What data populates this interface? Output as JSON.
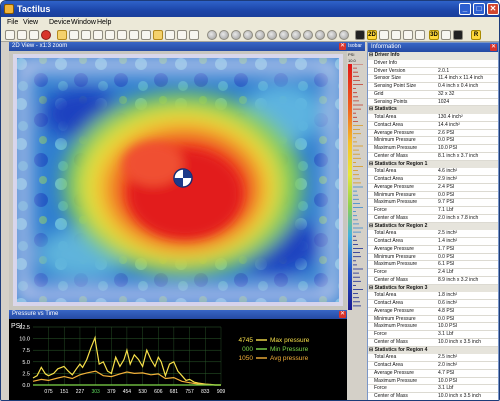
{
  "window": {
    "title": "Tactilus",
    "minimize": "_",
    "maximize": "□",
    "close": "✕"
  },
  "menu": [
    "File",
    "View",
    "Device",
    "Window",
    "Help"
  ],
  "view2d": {
    "title": "2D View - x1:3 zoom"
  },
  "isobar": {
    "title": "Isobar",
    "unit": "PSI",
    "top_value": "10.0"
  },
  "information": {
    "title": "Information",
    "rows": [
      {
        "type": "section",
        "label": "Driver Info"
      },
      {
        "type": "row",
        "label": "Driver Info",
        "value": ""
      },
      {
        "type": "row",
        "label": "Driver Version",
        "value": "2.0.1"
      },
      {
        "type": "row",
        "label": "Sensor Size",
        "value": "11.4 inch x 11.4 inch"
      },
      {
        "type": "row",
        "label": "Sensing Point Size",
        "value": "0.4 inch x 0.4 inch"
      },
      {
        "type": "row",
        "label": "Grid",
        "value": "32 x 32"
      },
      {
        "type": "row",
        "label": "Sensing Points",
        "value": "1024"
      },
      {
        "type": "section",
        "label": "Statistics"
      },
      {
        "type": "row",
        "label": "Total Area",
        "value": "130.4 inch²"
      },
      {
        "type": "row",
        "label": "Contact Area",
        "value": "14.4 inch²"
      },
      {
        "type": "row",
        "label": "Average Pressure",
        "value": "2.6 PSI"
      },
      {
        "type": "row",
        "label": "Minimum Pressure",
        "value": "0.0 PSI"
      },
      {
        "type": "row",
        "label": "Maximum Pressure",
        "value": "10.0 PSI"
      },
      {
        "type": "row",
        "label": "Center of Mass",
        "value": "8.1 inch x 3.7 inch"
      },
      {
        "type": "section",
        "label": "Statistics for Region 1"
      },
      {
        "type": "row",
        "label": "Total Area",
        "value": "4.6 inch²"
      },
      {
        "type": "row",
        "label": "Contact Area",
        "value": "2.9 inch²"
      },
      {
        "type": "row",
        "label": "Average Pressure",
        "value": "2.4 PSI"
      },
      {
        "type": "row",
        "label": "Minimum Pressure",
        "value": "0.0 PSI"
      },
      {
        "type": "row",
        "label": "Maximum Pressure",
        "value": "9.7 PSI"
      },
      {
        "type": "row",
        "label": "Force",
        "value": "7.1 Lbf"
      },
      {
        "type": "row",
        "label": "Center of Mass",
        "value": "2.0 inch x 7.8 inch"
      },
      {
        "type": "section",
        "label": "Statistics for Region 2"
      },
      {
        "type": "row",
        "label": "Total Area",
        "value": "2.5 inch²"
      },
      {
        "type": "row",
        "label": "Contact Area",
        "value": "1.4 inch²"
      },
      {
        "type": "row",
        "label": "Average Pressure",
        "value": "1.7 PSI"
      },
      {
        "type": "row",
        "label": "Minimum Pressure",
        "value": "0.0 PSI"
      },
      {
        "type": "row",
        "label": "Maximum Pressure",
        "value": "6.1 PSI"
      },
      {
        "type": "row",
        "label": "Force",
        "value": "2.4 Lbf"
      },
      {
        "type": "row",
        "label": "Center of Mass",
        "value": "8.9 inch x 3.2 inch"
      },
      {
        "type": "section",
        "label": "Statistics for Region 3"
      },
      {
        "type": "row",
        "label": "Total Area",
        "value": "1.8 inch²"
      },
      {
        "type": "row",
        "label": "Contact Area",
        "value": "0.6 inch²"
      },
      {
        "type": "row",
        "label": "Average Pressure",
        "value": "4.8 PSI"
      },
      {
        "type": "row",
        "label": "Minimum Pressure",
        "value": "0.0 PSI"
      },
      {
        "type": "row",
        "label": "Maximum Pressure",
        "value": "10.0 PSI"
      },
      {
        "type": "row",
        "label": "Force",
        "value": "3.1 Lbf"
      },
      {
        "type": "row",
        "label": "Center of Mass",
        "value": "10.0 inch x 3.5 inch"
      },
      {
        "type": "section",
        "label": "Statistics for Region 4"
      },
      {
        "type": "row",
        "label": "Total Area",
        "value": "2.5 inch²"
      },
      {
        "type": "row",
        "label": "Contact Area",
        "value": "2.0 inch²"
      },
      {
        "type": "row",
        "label": "Average Pressure",
        "value": "4.7 PSI"
      },
      {
        "type": "row",
        "label": "Maximum Pressure",
        "value": "10.0 PSI"
      },
      {
        "type": "row",
        "label": "Force",
        "value": "3.1 Lbf"
      },
      {
        "type": "row",
        "label": "Center of Mass",
        "value": "10.0 inch x 3.5 inch"
      }
    ]
  },
  "pressure_vs_time": {
    "title": "Pressure vs Time"
  },
  "chart_data": {
    "type": "line",
    "title": "",
    "ylabel": "PSI",
    "ylim": [
      0,
      12.5
    ],
    "yticks": [
      "12.5",
      "10.0",
      "7.5",
      "5.0",
      "2.5",
      "0.0"
    ],
    "xticks": [
      "075",
      "151",
      "227",
      "303",
      "379",
      "454",
      "530",
      "606",
      "681",
      "757",
      "833",
      "909"
    ],
    "highlight_tick": "303",
    "legend": [
      {
        "value": "4745",
        "label": "Max pressure",
        "color": "#f7e04a"
      },
      {
        "value": "000",
        "label": "Min Pressure",
        "color": "#7fd94a"
      },
      {
        "value": "1050",
        "label": "Avg pressure",
        "color": "#f3b03a"
      }
    ],
    "series": [
      {
        "name": "Max pressure",
        "color": "#f7e04a",
        "x": [
          0,
          20,
          40,
          60,
          75,
          100,
          120,
          150,
          170,
          190,
          210,
          227,
          240,
          260,
          280,
          300,
          303,
          320,
          340,
          360,
          379,
          400,
          420,
          440,
          454,
          470,
          490,
          510,
          530,
          550,
          570,
          590,
          606,
          620,
          640,
          660,
          681,
          700,
          720,
          740,
          757,
          780,
          800,
          833,
          860,
          880,
          909
        ],
        "values": [
          1.5,
          2.0,
          3.8,
          2.4,
          2.0,
          2.5,
          3.5,
          4.0,
          3.0,
          2.2,
          3.5,
          4.5,
          3.8,
          5.5,
          8.0,
          10.2,
          9.0,
          4.5,
          5.0,
          3.0,
          2.5,
          6.0,
          4.0,
          5.5,
          7.5,
          4.5,
          6.5,
          5.5,
          4.0,
          7.5,
          5.5,
          4.0,
          6.0,
          5.0,
          2.0,
          4.5,
          5.0,
          3.0,
          2.0,
          1.0,
          1.2,
          0.6,
          0.4,
          0.2,
          0.1,
          0.0,
          0.0
        ]
      },
      {
        "name": "Avg pressure",
        "color": "#f3b03a",
        "x": [
          0,
          40,
          75,
          120,
          151,
          190,
          227,
          260,
          303,
          340,
          379,
          420,
          454,
          490,
          530,
          570,
          606,
          640,
          681,
          720,
          757,
          800,
          833,
          880,
          909
        ],
        "values": [
          0.8,
          1.2,
          1.0,
          1.5,
          1.8,
          1.4,
          2.2,
          2.6,
          3.0,
          2.0,
          1.8,
          2.4,
          2.8,
          2.5,
          2.6,
          2.2,
          2.4,
          1.4,
          1.6,
          0.8,
          0.5,
          0.2,
          0.1,
          0.0,
          0.0
        ]
      },
      {
        "name": "Min Pressure",
        "color": "#7fd94a",
        "x": [
          0,
          909
        ],
        "values": [
          0.0,
          0.0
        ]
      }
    ]
  },
  "colors": {
    "title_blue": "#1c45a8",
    "chart_bg": "#000000",
    "grid": "#2e5e2e"
  }
}
